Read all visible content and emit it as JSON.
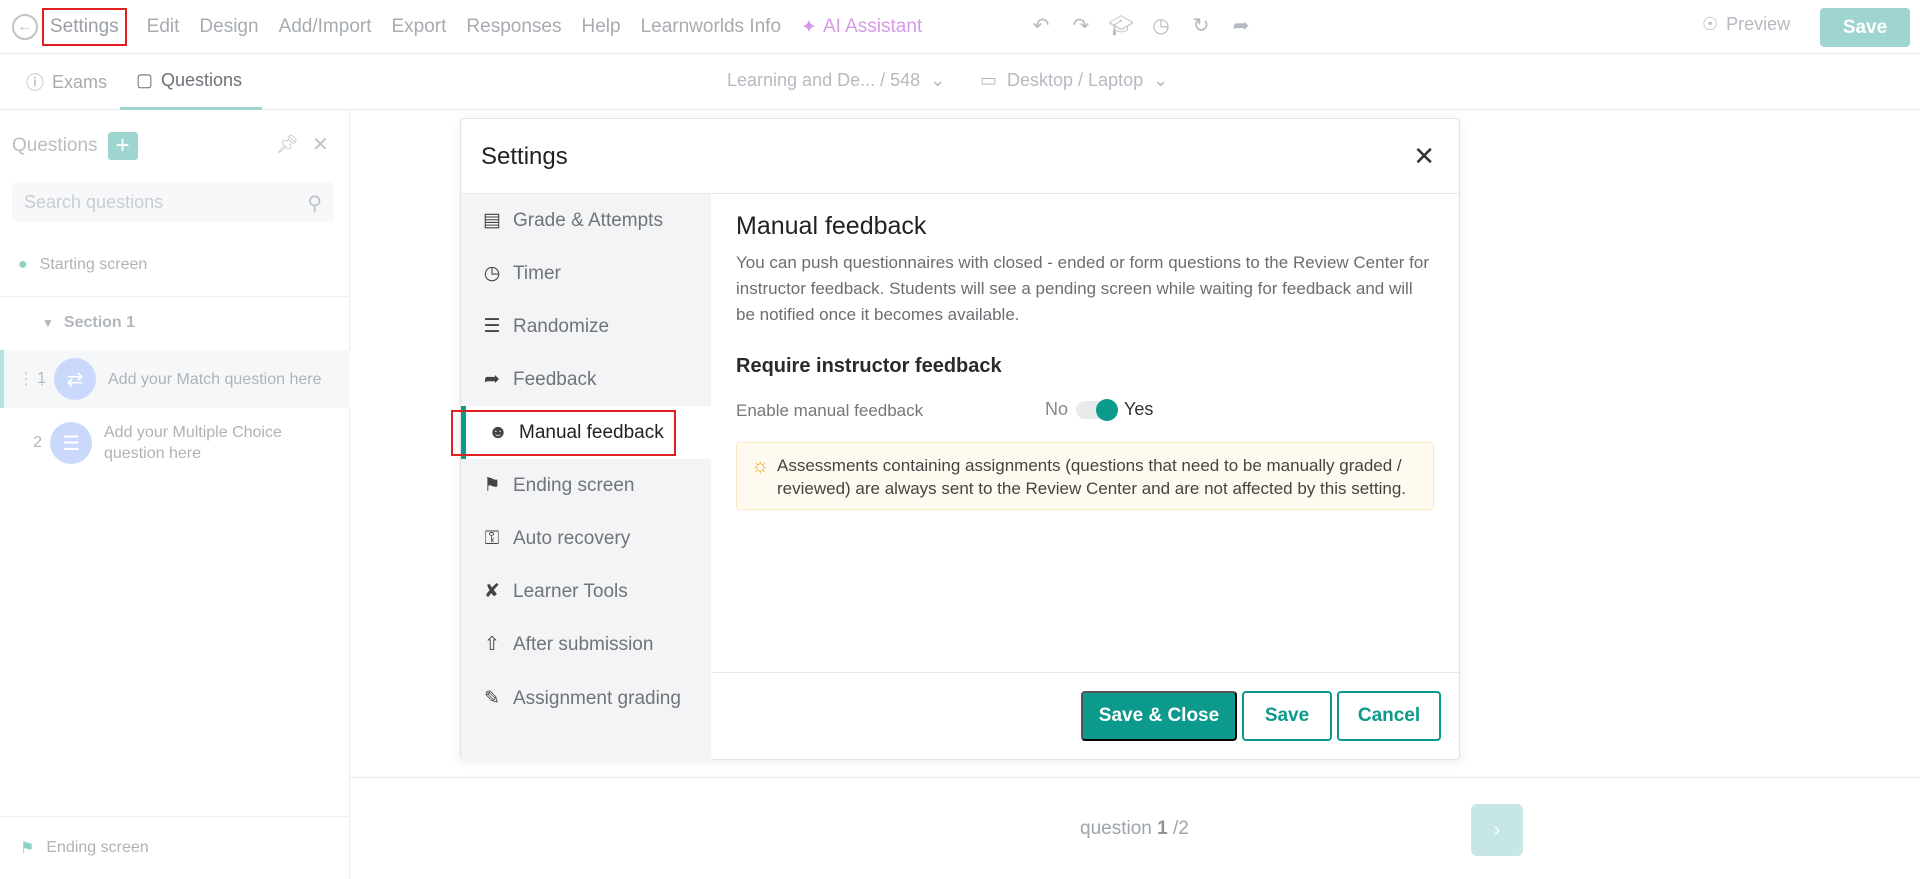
{
  "topbar": {
    "menu": [
      "Settings",
      "Edit",
      "Design",
      "Add/Import",
      "Export",
      "Responses",
      "Help",
      "Learnworlds Info"
    ],
    "ai_assistant": "AI Assistant",
    "preview": "Preview",
    "save": "Save"
  },
  "subbar": {
    "tabs": [
      "Exams",
      "Questions"
    ],
    "course": "Learning and De... / 548",
    "device": "Desktop / Laptop"
  },
  "sidebar": {
    "title": "Questions",
    "search_placeholder": "Search questions",
    "starting_screen": "Starting screen",
    "section": "Section 1",
    "questions": [
      {
        "num": "1",
        "text": "Add your Match question here"
      },
      {
        "num": "2",
        "text": "Add your Multiple Choice question here"
      }
    ],
    "ending_screen": "Ending screen"
  },
  "pager": {
    "label": "question",
    "current": "1",
    "total": "/2"
  },
  "modal": {
    "title": "Settings",
    "nav": [
      {
        "label": "Grade & Attempts",
        "icon": "grade-icon"
      },
      {
        "label": "Timer",
        "icon": "clock-icon"
      },
      {
        "label": "Randomize",
        "icon": "sliders-icon"
      },
      {
        "label": "Feedback",
        "icon": "share-arrow-icon"
      },
      {
        "label": "Manual feedback",
        "icon": "user-feedback-icon"
      },
      {
        "label": "Ending screen",
        "icon": "flag-icon"
      },
      {
        "label": "Auto recovery",
        "icon": "lock-icon"
      },
      {
        "label": "Learner Tools",
        "icon": "tools-icon"
      },
      {
        "label": "After submission",
        "icon": "upload-doc-icon"
      },
      {
        "label": "Assignment grading",
        "icon": "edit-doc-icon"
      }
    ],
    "content": {
      "title": "Manual feedback",
      "description": "You can push questionnaires with closed - ended or form questions to the Review Center for instructor feedback. Students will see a pending screen while waiting for feedback and will be notified once it becomes available.",
      "subtitle": "Require instructor feedback",
      "enable_label": "Enable manual feedback",
      "toggle_no": "No",
      "toggle_yes": "Yes",
      "note": "Assessments containing assignments (questions that need to be manually graded / reviewed) are always sent to the Review Center and are not affected by this setting."
    },
    "buttons": {
      "save_close": "Save & Close",
      "save": "Save",
      "cancel": "Cancel"
    }
  },
  "colors": {
    "accent": "#0c9a8d",
    "highlight": "#e02020"
  }
}
